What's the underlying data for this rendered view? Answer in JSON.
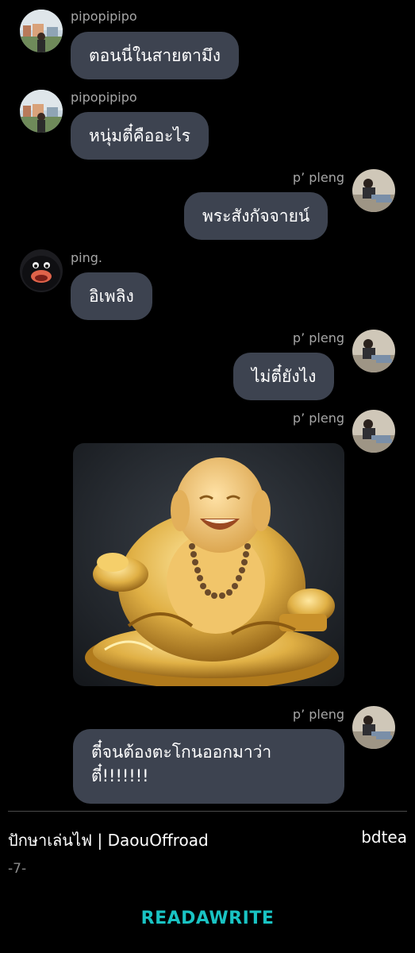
{
  "colors": {
    "background": "#000000",
    "bubble": "#3d4350",
    "sender_name": "#a6a6a6",
    "logo": "#19c3c3"
  },
  "messages": [
    {
      "sender": "pipopipipo",
      "side": "left",
      "text": "ตอนนี่ในสายตามึง",
      "avatar": "avatar-pipopipipo-icon"
    },
    {
      "sender": "pipopipipo",
      "side": "left",
      "text": "หนุ่มตี๋คืออะไร",
      "avatar": "avatar-pipopipipo-icon"
    },
    {
      "sender": "p’ pleng",
      "side": "right",
      "text": "พระสังกัจจายน์",
      "avatar": "avatar-ppleng-icon"
    },
    {
      "sender": "ping.",
      "side": "left",
      "text": "อิเพลิง",
      "avatar": "avatar-ping-penguin-icon"
    },
    {
      "sender": "p’ pleng",
      "side": "right",
      "text": "ไม่ตี๋ยังไง",
      "avatar": "avatar-ppleng-icon"
    },
    {
      "sender": "p’ pleng",
      "side": "right",
      "image": "laughing-golden-buddha-image",
      "avatar": "avatar-ppleng-icon"
    },
    {
      "sender": "p’ pleng",
      "side": "right",
      "text": "ตี๋จนต้องตะโกนออกมาว่า ตี๋!!!!!!!",
      "avatar": "avatar-ppleng-icon"
    }
  ],
  "footer": {
    "story_title": "ปักษาเล่นไฟ | DaouOffroad",
    "author": "bdtea",
    "page": "-7-",
    "logo_text": "READAWRITE"
  }
}
